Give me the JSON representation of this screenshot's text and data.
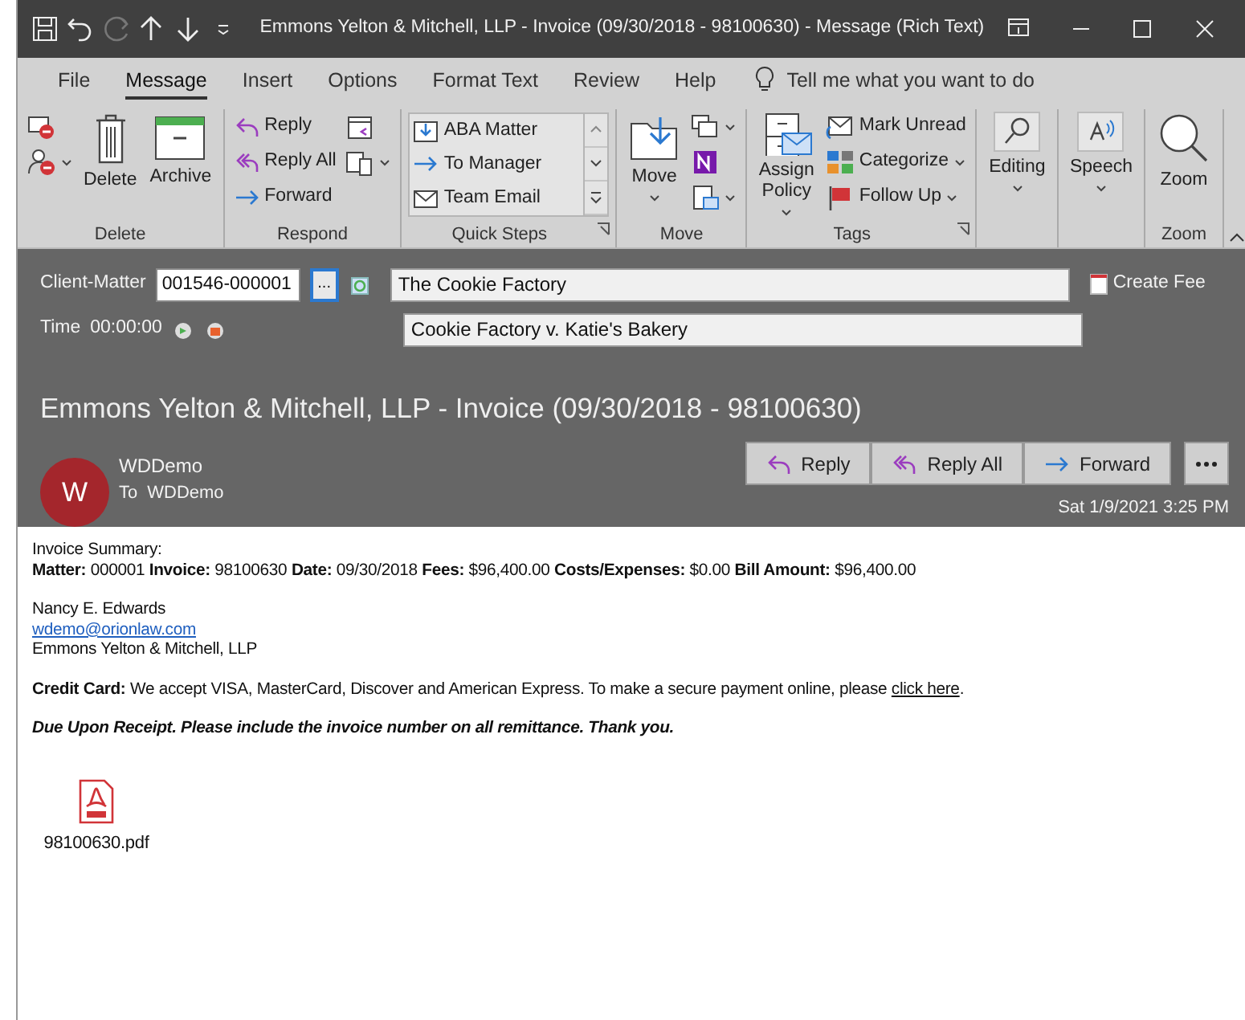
{
  "title_bar": {
    "title": "Emmons Yelton & Mitchell, LLP - Invoice (09/30/2018 -  98100630)  -  Message (Rich Text)"
  },
  "menu_tabs": [
    {
      "label": "File",
      "selected": false
    },
    {
      "label": "Message",
      "selected": true
    },
    {
      "label": "Insert",
      "selected": false
    },
    {
      "label": "Options",
      "selected": false
    },
    {
      "label": "Format Text",
      "selected": false
    },
    {
      "label": "Review",
      "selected": false
    },
    {
      "label": "Help",
      "selected": false
    }
  ],
  "tell_me": {
    "placeholder": "Tell me what you want to do"
  },
  "ribbon_groups": [
    {
      "label": "Delete",
      "launcher": false,
      "kind": "buttons",
      "buttons": [
        {
          "kind": "icon",
          "dropdown": false
        },
        {
          "kind": "icon",
          "dropdown": true
        },
        {
          "kind": "large",
          "label": "Delete",
          "dropdown": false
        },
        {
          "kind": "large",
          "label": "Archive",
          "dropdown": false
        }
      ]
    },
    {
      "label": "Respond",
      "launcher": false,
      "kind": "buttons",
      "buttons": [
        {
          "kind": "small",
          "label": "Reply",
          "dropdown": false
        },
        {
          "kind": "small",
          "label": "Reply All",
          "dropdown": false
        },
        {
          "kind": "small",
          "label": "Forward",
          "dropdown": false
        },
        {
          "kind": "icon",
          "dropdown": false
        },
        {
          "kind": "icon",
          "dropdown": true
        }
      ]
    },
    {
      "label": "Quick Steps",
      "launcher": true,
      "kind": "gallery",
      "buttons": [
        {
          "label": "ABA Matter",
          "dropdown": false
        },
        {
          "label": "To Manager",
          "dropdown": false
        },
        {
          "label": "Team Email",
          "dropdown": false
        }
      ]
    },
    {
      "label": "Move",
      "launcher": false,
      "kind": "buttons",
      "buttons": [
        {
          "kind": "large",
          "label": "Move",
          "dropdown": true
        },
        {
          "kind": "icon",
          "dropdown": true
        },
        {
          "kind": "icon",
          "dropdown": false
        },
        {
          "kind": "icon",
          "dropdown": true
        }
      ]
    },
    {
      "label": "Tags",
      "launcher": true,
      "kind": "buttons",
      "buttons": [
        {
          "kind": "large",
          "label": "Assign Policy",
          "dropdown": true
        },
        {
          "kind": "small",
          "label": "Mark Unread",
          "dropdown": false
        },
        {
          "kind": "small",
          "label": "Categorize",
          "dropdown": true
        },
        {
          "kind": "small",
          "label": "Follow Up",
          "dropdown": true
        }
      ]
    },
    {
      "launcher": false,
      "kind": "buttons",
      "buttons": [
        {
          "kind": "large",
          "label": "Editing",
          "dropdown": true
        }
      ]
    },
    {
      "launcher": false,
      "kind": "buttons",
      "buttons": [
        {
          "kind": "large",
          "label": "Speech",
          "dropdown": true
        }
      ]
    },
    {
      "label": "Zoom",
      "launcher": false,
      "kind": "buttons",
      "buttons": [
        {
          "kind": "large",
          "label": "Zoom",
          "dropdown": false
        }
      ]
    }
  ],
  "client_matter": {
    "label": "Client-Matter",
    "value": "001546-000001",
    "browse": "...",
    "client": "The Cookie Factory",
    "time_label": "Time",
    "time": "00:00:00",
    "matter": "Cookie Factory v. Katie's Bakery",
    "create_fee": {
      "label": "Create Fee",
      "checked": false
    }
  },
  "message_header": {
    "subject": "Emmons Yelton & Mitchell, LLP - Invoice (09/30/2018 -  98100630)",
    "avatar": "W",
    "sender": "WDDemo",
    "to_label": "To",
    "to": "WDDemo",
    "actions": [
      "Reply",
      "Reply All",
      "Forward"
    ],
    "date": "Sat 1/9/2021 3:25 PM"
  },
  "body": {
    "summary_title": "Invoice Summary:",
    "summary": "**Matter:** 000001 **Invoice:** 98100630 **Date:** 09/30/2018 **Fees:** $96,400.00 **Costs/Expenses:** $0.00 **Bill Amount:** $96,400.00",
    "signature_name": "Nancy E. Edwards",
    "signature_email": "wdemo@orionlaw.com",
    "signature_firm": "Emmons Yelton & Mitchell, LLP",
    "credit_card": {
      "text": "**Credit Card:** We accept VISA, MasterCard, Discover and American Express.  To make a secure payment online, please ",
      "link": "click here",
      "after": "."
    },
    "notice": "Due Upon Receipt.  Please include the invoice number on all remittance.  Thank you.",
    "attachment": "98100630.pdf"
  }
}
